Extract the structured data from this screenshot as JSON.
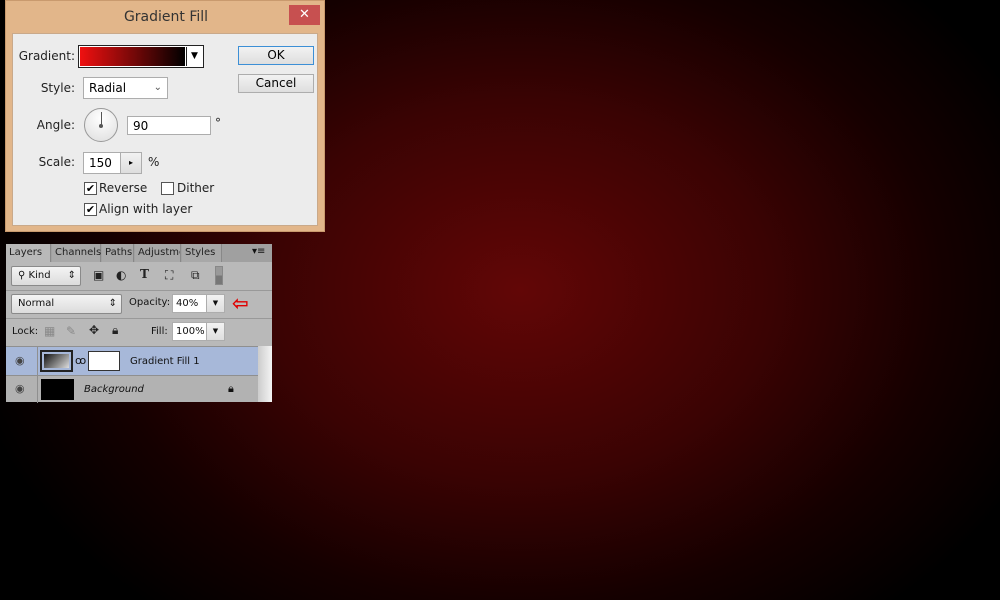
{
  "dialog": {
    "title": "Gradient Fill",
    "close": "✕",
    "gradient_label": "Gradient:",
    "gradient_colors": [
      "#f01010",
      "#000000"
    ],
    "style_label": "Style:",
    "style_value": "Radial",
    "angle_label": "Angle:",
    "angle_value": "90",
    "angle_unit": "°",
    "scale_label": "Scale:",
    "scale_value": "150",
    "scale_unit": "%",
    "reverse_label": "Reverse",
    "reverse_checked": true,
    "dither_label": "Dither",
    "dither_checked": false,
    "align_label": "Align with layer",
    "align_checked": true,
    "ok": "OK",
    "cancel": "Cancel"
  },
  "layers": {
    "tabs": [
      "Layers",
      "Channels",
      "Paths",
      "Adjustme",
      "Styles"
    ],
    "kind": "Kind",
    "blend_mode": "Normal",
    "opacity_label": "Opacity:",
    "opacity_value": "40%",
    "lock_label": "Lock:",
    "fill_label": "Fill:",
    "fill_value": "100%",
    "items": [
      {
        "name": "Gradient Fill 1",
        "selected": true
      },
      {
        "name": "Background",
        "locked": true
      }
    ]
  },
  "annotation": {
    "arrow_color": "#e00000"
  }
}
